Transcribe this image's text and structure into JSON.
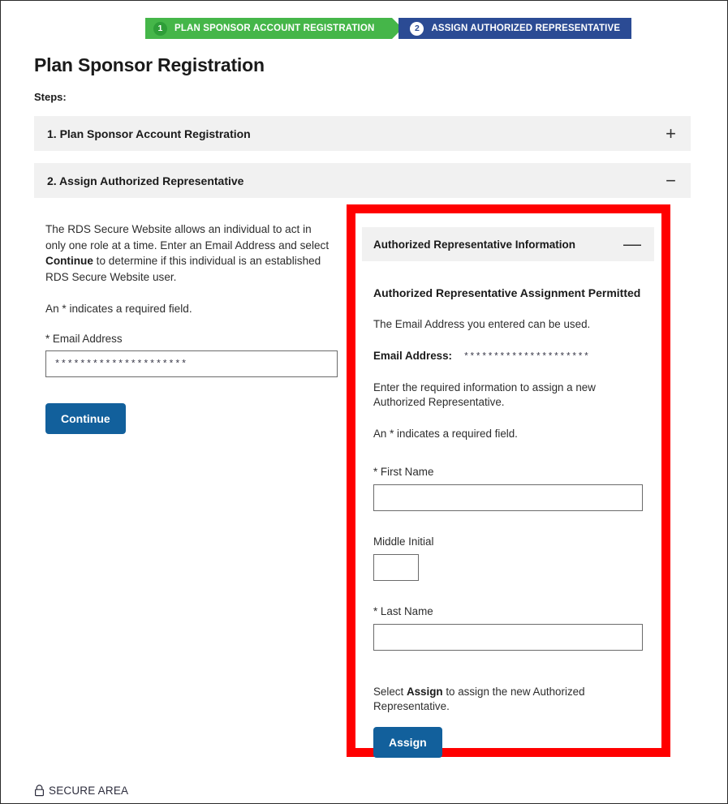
{
  "progress": {
    "steps": [
      {
        "number": "1",
        "label": "PLAN SPONSOR ACCOUNT REGISTRATION",
        "state": "completed",
        "color": "#45b649"
      },
      {
        "number": "2",
        "label": "ASSIGN AUTHORIZED REPRESENTATIVE",
        "state": "current",
        "color": "#2b4b94"
      }
    ]
  },
  "header": {
    "title": "Plan Sponsor Registration",
    "steps_label": "Steps:"
  },
  "accordions": [
    {
      "title": "1. Plan Sponsor Account Registration",
      "toggle": "+",
      "expanded": false
    },
    {
      "title": "2. Assign Authorized Representative",
      "toggle": "−",
      "expanded": true
    }
  ],
  "left": {
    "intro_part1": "The RDS Secure Website allows an individual to act in only one role at a time. Enter an Email Address and select ",
    "intro_bold": "Continue",
    "intro_part2": " to determine if this individual is an established RDS Secure Website user.",
    "required_note": "An * indicates a required field.",
    "email_label": "* Email Address",
    "email_value": "*********************",
    "email_placeholder": "",
    "continue_label": "Continue"
  },
  "right": {
    "panel_title": "Authorized Representative Information",
    "panel_toggle": "—",
    "heading": "Authorized Representative Assignment Permitted",
    "permitted_text": "The Email Address you entered can be used.",
    "email_label": "Email Address:",
    "email_value": "*********************",
    "enter_info_text": "Enter the required information to assign a new Authorized Representative.",
    "required_note": "An * indicates a required field.",
    "fields": [
      {
        "label": "* First Name",
        "value": "",
        "placeholder": "",
        "size": "wide",
        "name": "first-name"
      },
      {
        "label": "Middle Initial",
        "value": "",
        "placeholder": "",
        "size": "mini",
        "name": "middle-initial"
      },
      {
        "label": "* Last Name",
        "value": "",
        "placeholder": "",
        "size": "wide",
        "name": "last-name"
      }
    ],
    "assign_note_part1": "Select ",
    "assign_note_bold": "Assign",
    "assign_note_part2": " to assign the new Authorized Representative.",
    "assign_label": "Assign"
  },
  "footer": {
    "secure_area": "SECURE AREA",
    "lock_icon": "lock-icon"
  },
  "highlight": {
    "color": "#ff0000",
    "target": "authorized-representative-information-panel"
  }
}
